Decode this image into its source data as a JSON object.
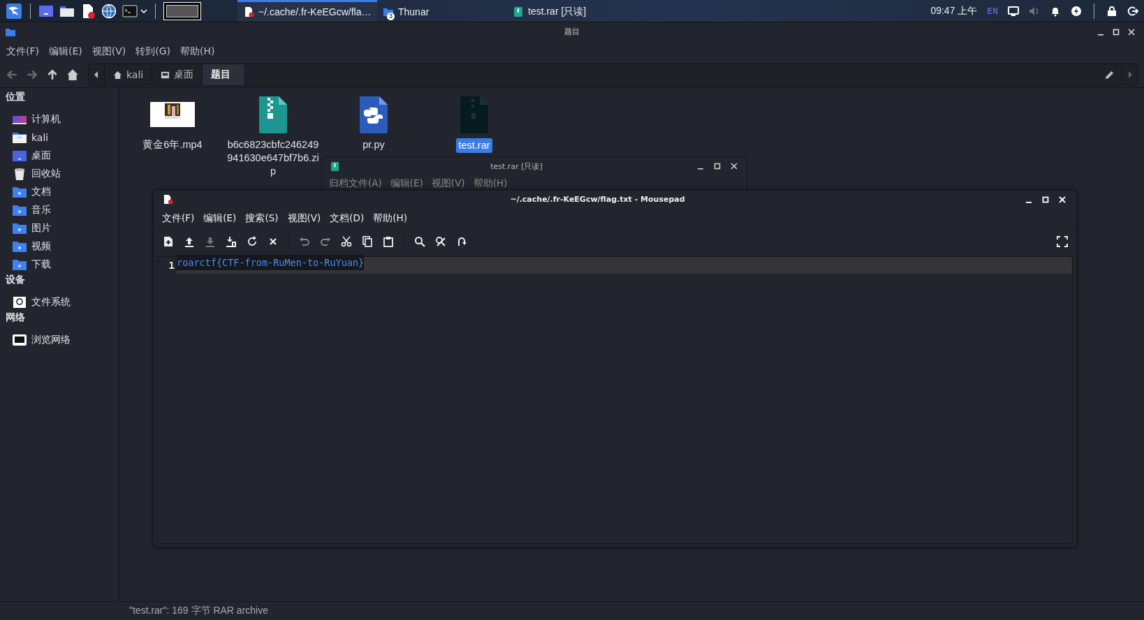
{
  "top_panel": {
    "tasks": [
      {
        "label": "~/.cache/.fr-KeEGcw/fla…",
        "kind": "editor",
        "selected": true
      },
      {
        "label": "Thunar",
        "kind": "folder",
        "badge": "3",
        "selected": false
      },
      {
        "label": "test.rar [只读]",
        "kind": "archive",
        "selected": false
      }
    ],
    "clock": "09:47 上午",
    "keyboard_layout": "EN"
  },
  "file_manager": {
    "title": "题目",
    "menu": [
      "文件(F)",
      "编辑(E)",
      "视图(V)",
      "转到(G)",
      "帮助(H)"
    ],
    "breadcrumbs": [
      {
        "label": "kali",
        "kind": "home",
        "selected": false
      },
      {
        "label": "桌面",
        "kind": "desktop",
        "selected": false
      },
      {
        "label": "题目",
        "kind": "folder",
        "selected": true
      }
    ],
    "sidebar": [
      {
        "title": "位置",
        "items": [
          {
            "label": "计算机",
            "kind": "computer"
          },
          {
            "label": "kali",
            "kind": "home"
          },
          {
            "label": "桌面",
            "kind": "desktop"
          },
          {
            "label": "回收站",
            "kind": "trash"
          },
          {
            "label": "文档",
            "kind": "documents"
          },
          {
            "label": "音乐",
            "kind": "music"
          },
          {
            "label": "图片",
            "kind": "pictures"
          },
          {
            "label": "视频",
            "kind": "videos"
          },
          {
            "label": "下载",
            "kind": "downloads"
          }
        ]
      },
      {
        "title": "设备",
        "items": [
          {
            "label": "文件系统",
            "kind": "drive"
          }
        ]
      },
      {
        "title": "网络",
        "items": [
          {
            "label": "浏览网络",
            "kind": "network"
          }
        ]
      }
    ],
    "files": [
      {
        "name": "黄金6年.mp4",
        "kind": "video",
        "selected": false
      },
      {
        "name": "b6c6823cbfc246249941630e647bf7b6.zip",
        "kind": "zip",
        "selected": false
      },
      {
        "name": "pr.py",
        "kind": "python",
        "selected": false
      },
      {
        "name": "test.rar",
        "kind": "rar",
        "selected": true
      }
    ],
    "status_bar": "\"test.rar\": 169 字节 RAR archive"
  },
  "archive_window": {
    "title": "test.rar [只读]",
    "menu": [
      "归档文件(A)",
      "编辑(E)",
      "视图(V)",
      "帮助(H)"
    ]
  },
  "editor": {
    "title": "~/.cache/.fr-KeEGcw/flag.txt - Mousepad",
    "menu": [
      "文件(F)",
      "编辑(E)",
      "搜索(S)",
      "视图(V)",
      "文档(D)",
      "帮助(H)"
    ],
    "lines": [
      {
        "number": "1",
        "text": "roarctf{CTF-from-RuMen-to-RuYuan}"
      }
    ]
  }
}
